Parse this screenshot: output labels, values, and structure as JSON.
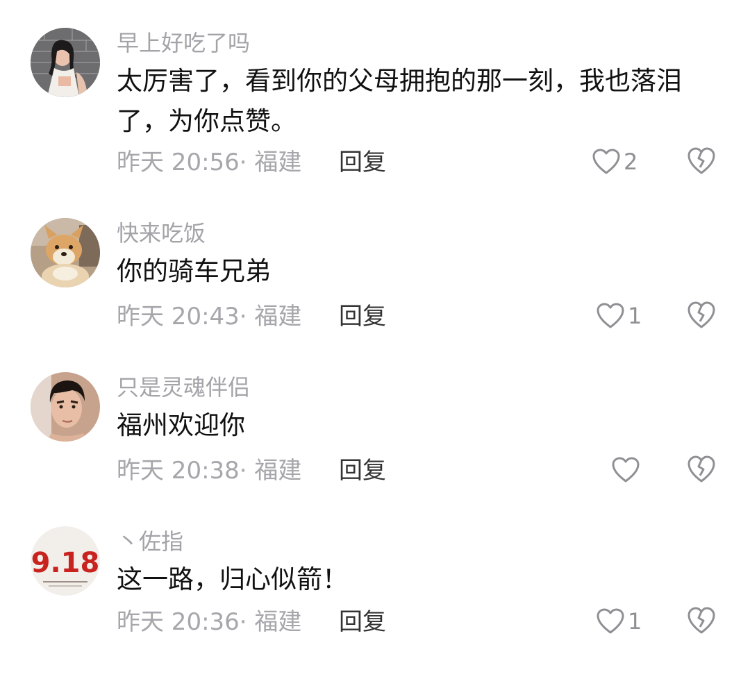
{
  "comments": [
    {
      "username": "早上好吃了吗",
      "text": "太厉害了，看到你的父母拥抱的那一刻，我也落泪了，为你点赞。",
      "meta": "昨天 20:56· 福建",
      "reply_label": "回复",
      "likes": "2",
      "avatar": "woman-portrait"
    },
    {
      "username": "快来吃饭",
      "text": "你的骑车兄弟",
      "meta": "昨天 20:43· 福建",
      "reply_label": "回复",
      "likes": "1",
      "avatar": "shiba-dog"
    },
    {
      "username": "只是灵魂伴侣",
      "text": "福州欢迎你",
      "meta": "昨天 20:38· 福建",
      "reply_label": "回复",
      "likes": "",
      "avatar": "man-portrait"
    },
    {
      "username": "丶佐指",
      "text": "这一路，归心似箭！",
      "meta": "昨天 20:36· 福建",
      "reply_label": "回复",
      "likes": "1",
      "avatar": "918-logo",
      "avatar_text": "9.18"
    }
  ],
  "icons": {
    "like": "heart-outline-icon",
    "dislike": "broken-heart-icon"
  },
  "colors": {
    "username": "#a3a3a8",
    "meta": "#a6a6ab",
    "text": "#111111",
    "icon": "#8f8f94"
  }
}
